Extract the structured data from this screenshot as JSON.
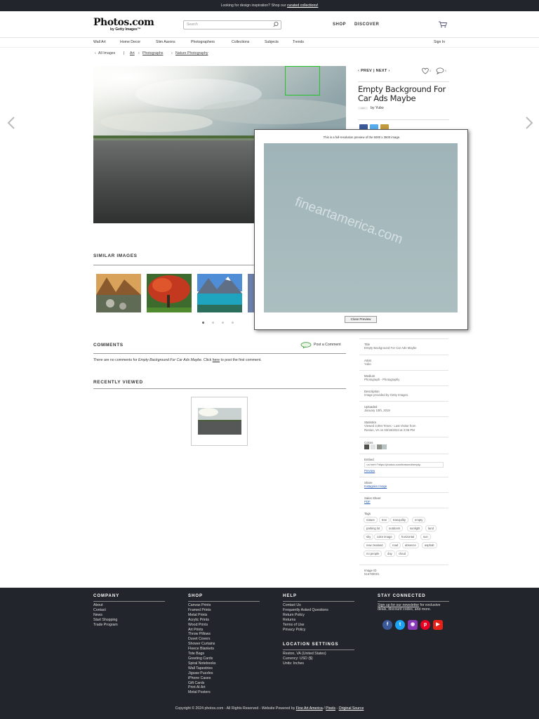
{
  "banner": {
    "text": "Looking for design inspiration? Shop our ",
    "link": "curated collections!"
  },
  "header": {
    "logo": "Photos.com",
    "logo_sub": "by Getty Images™",
    "search_placeholder": "Search",
    "shop": "SHOP",
    "discover": "DISCOVER"
  },
  "nav": [
    "Wall Art",
    "Home Decor",
    "Slim Aarons",
    "Photographers",
    "Collections",
    "Subjects",
    "Trends"
  ],
  "nav_signin": "Sign In",
  "breadcrumb": {
    "all_images": "All Images",
    "sep": "|",
    "art": "Art",
    "photographs": "Photographs",
    "nature": "Nature Photography"
  },
  "artwork": {
    "prev": "PREV",
    "next": "NEXT",
    "likes": "0",
    "comments": "0",
    "title": "Empty Background For Car Ads Maybe",
    "by": "by Yubo"
  },
  "popup": {
    "caption": "This is a full-resolution preview of the 5000 x 3500 image.",
    "watermark": "fineartamerica.com",
    "close": "Close Preview"
  },
  "similar": {
    "heading": "SIMILAR IMAGES"
  },
  "comments": {
    "heading": "COMMENTS",
    "post": "Post a Comment",
    "text_pre": "There are no comments for ",
    "text_title": "Empty Background For Car Ads Maybe",
    "text_mid": ".   Click ",
    "text_link": "here",
    "text_post": " to post the first comment."
  },
  "recently": {
    "heading": "RECENTLY VIEWED"
  },
  "details": {
    "title_label": "Title",
    "title_val": "Empty Background For Car Ads Maybe",
    "artist_label": "Artist",
    "artist_val": "Yubo",
    "medium_label": "Medium",
    "medium_val": "Photograph - Photography",
    "desc_label": "Description",
    "desc_val": "Image provided by Getty Images.",
    "uploaded_label": "Uploaded",
    "uploaded_val": "January 10th, 2019",
    "stats_label": "Statistics",
    "stats_val1": "Viewed 3,094 Times  -  Last Visitor from",
    "stats_val2": "Reston, VA on 03/19/2024 at 2:05 PM",
    "colors_label": "Colors",
    "colors": [
      "#4f524d",
      "#dfe3e3",
      "#8c9089",
      "#b7c3c1"
    ],
    "embed_label": "Embed",
    "embed_val": "<a href=\"https://photos.com/featured/empty-",
    "embed_preview": "Preview",
    "share_label": "Share",
    "share_val": "Instagram Image",
    "sales_label": "Sales Sheet",
    "sales_val": "PDF",
    "tags_label": "Tags",
    "tags": [
      "nature",
      "tree",
      "tranquility",
      "empty",
      "parking lot",
      "outdoors",
      "sunlight",
      "land",
      "sky",
      "color image",
      "horizontal",
      "sun",
      "new zealand",
      "road",
      "absence",
      "asphalt",
      "no people",
      "day",
      "cloud"
    ],
    "id_label": "Image ID",
    "id_val": "516788001"
  },
  "footer": {
    "company_h": "COMPANY",
    "company": [
      "About",
      "Contact",
      "News",
      "Start Shopping",
      "Trade Program"
    ],
    "shop_h": "SHOP",
    "shop": [
      "Canvas Prints",
      "Framed Prints",
      "Metal Prints",
      "Acrylic Prints",
      "Wood Prints",
      "Art Prints",
      "Throw Pillows",
      "Duvet Covers",
      "Shower Curtains",
      "Fleece Blankets",
      "Tote Bags",
      "Greeting Cards",
      "Spiral Notebooks",
      "Wall Tapestries",
      "Jigsaw Puzzles",
      "iPhone Cases",
      "Gift Cards",
      "Print AI Art",
      "Metal Posters"
    ],
    "help_h": "HELP",
    "help": [
      "Contact Us",
      "Frequently Asked Questions",
      "Return Policy",
      "Returns",
      "Terms of Use",
      "Privacy Policy"
    ],
    "location_h": "LOCATION SETTINGS",
    "location": [
      "Reston, VA (United States)",
      "Currency: USD ($)",
      "Units: Inches"
    ],
    "stay_h": "STAY CONNECTED",
    "newsletter_link": "Sign up for our newsletter",
    "newsletter_rest": " for exclusive deals, discount codes, and more.",
    "copy_pre": "Copyright © 2024 photos.com - All Rights Reserved - Website Powered by ",
    "copy_faa": "Fine Art America",
    "copy_sep": " / ",
    "copy_pixels": "Pixels",
    "copy_dash": " - ",
    "copy_source": "Original Source"
  }
}
